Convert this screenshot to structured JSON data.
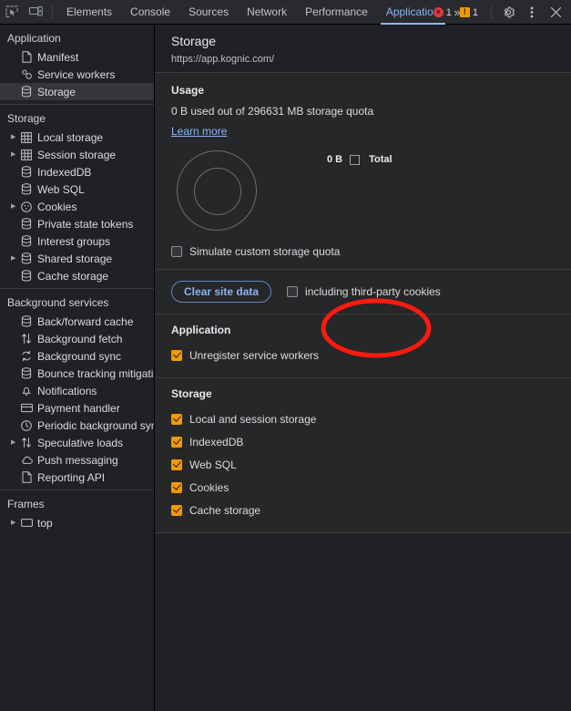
{
  "toolbar": {
    "inspect_icon": "inspect-element-icon",
    "device_icon": "device-toolbar-icon",
    "tabs": [
      {
        "label": "Elements",
        "active": false
      },
      {
        "label": "Console",
        "active": false
      },
      {
        "label": "Sources",
        "active": false
      },
      {
        "label": "Network",
        "active": false
      },
      {
        "label": "Performance",
        "active": false
      },
      {
        "label": "Application",
        "active": true
      }
    ],
    "more_tabs": "»",
    "error_count": "1",
    "warning_count": "1",
    "error_glyph": "×",
    "warning_glyph": "!",
    "settings_icon": "gear-icon",
    "menu_icon": "kebab-menu-icon",
    "close_icon": "close-icon",
    "accent_color": "#8ab4f8",
    "error_color": "#e03a3a",
    "warning_color": "#f29900"
  },
  "sidebar": {
    "sections": [
      {
        "title": "Application",
        "items": [
          {
            "label": "Manifest",
            "icon": "document-icon",
            "expandable": false,
            "selected": false
          },
          {
            "label": "Service workers",
            "icon": "gears-icon",
            "expandable": false,
            "selected": false
          },
          {
            "label": "Storage",
            "icon": "database-icon",
            "expandable": false,
            "selected": true
          }
        ]
      },
      {
        "title": "Storage",
        "items": [
          {
            "label": "Local storage",
            "icon": "table-icon",
            "expandable": true,
            "selected": false
          },
          {
            "label": "Session storage",
            "icon": "table-icon",
            "expandable": true,
            "selected": false
          },
          {
            "label": "IndexedDB",
            "icon": "database-icon",
            "expandable": false,
            "selected": false
          },
          {
            "label": "Web SQL",
            "icon": "database-icon",
            "expandable": false,
            "selected": false
          },
          {
            "label": "Cookies",
            "icon": "cookie-icon",
            "expandable": true,
            "selected": false
          },
          {
            "label": "Private state tokens",
            "icon": "database-icon",
            "expandable": false,
            "selected": false
          },
          {
            "label": "Interest groups",
            "icon": "database-icon",
            "expandable": false,
            "selected": false
          },
          {
            "label": "Shared storage",
            "icon": "database-icon",
            "expandable": true,
            "selected": false
          },
          {
            "label": "Cache storage",
            "icon": "database-icon",
            "expandable": false,
            "selected": false
          }
        ]
      },
      {
        "title": "Background services",
        "items": [
          {
            "label": "Back/forward cache",
            "icon": "database-icon",
            "expandable": false,
            "selected": false
          },
          {
            "label": "Background fetch",
            "icon": "arrows-updown-icon",
            "expandable": false,
            "selected": false
          },
          {
            "label": "Background sync",
            "icon": "sync-icon",
            "expandable": false,
            "selected": false
          },
          {
            "label": "Bounce tracking mitigations",
            "icon": "database-icon",
            "expandable": false,
            "selected": false
          },
          {
            "label": "Notifications",
            "icon": "bell-icon",
            "expandable": false,
            "selected": false
          },
          {
            "label": "Payment handler",
            "icon": "credit-card-icon",
            "expandable": false,
            "selected": false
          },
          {
            "label": "Periodic background sync",
            "icon": "clock-icon",
            "expandable": false,
            "selected": false
          },
          {
            "label": "Speculative loads",
            "icon": "arrows-updown-icon",
            "expandable": true,
            "selected": false
          },
          {
            "label": "Push messaging",
            "icon": "cloud-icon",
            "expandable": false,
            "selected": false
          },
          {
            "label": "Reporting API",
            "icon": "document-icon",
            "expandable": false,
            "selected": false
          }
        ]
      },
      {
        "title": "Frames",
        "items": [
          {
            "label": "top",
            "icon": "frame-icon",
            "expandable": true,
            "selected": false
          }
        ]
      }
    ]
  },
  "main": {
    "title": "Storage",
    "origin": "https://app.kognic.com/",
    "usage": {
      "title": "Usage",
      "summary": "0 B used out of 296631 MB storage quota",
      "learn_more": "Learn more",
      "legend_value": "0 B",
      "legend_label": "Total",
      "simulate_label": "Simulate custom storage quota",
      "simulate_checked": false
    },
    "clear": {
      "button_label": "Clear site data",
      "third_party_label": "including third-party cookies",
      "third_party_checked": false
    },
    "application_section": {
      "title": "Application",
      "items": [
        {
          "label": "Unregister service workers",
          "checked": true
        }
      ]
    },
    "storage_section": {
      "title": "Storage",
      "items": [
        {
          "label": "Local and session storage",
          "checked": true
        },
        {
          "label": "IndexedDB",
          "checked": true
        },
        {
          "label": "Web SQL",
          "checked": true
        },
        {
          "label": "Cookies",
          "checked": true
        },
        {
          "label": "Cache storage",
          "checked": true
        }
      ]
    }
  },
  "annotation": {
    "shape": "ellipse",
    "color": "#ff1a0f",
    "target": "clear-site-data-button"
  }
}
